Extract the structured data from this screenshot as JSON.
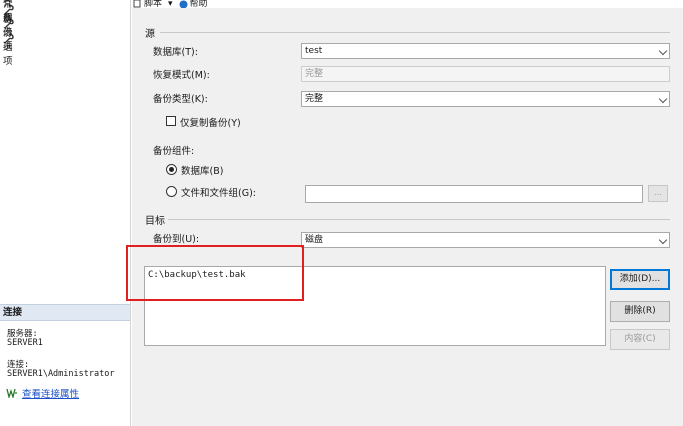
{
  "left_pane": {
    "pages": [
      "常规",
      "介质选项",
      "备份选项"
    ],
    "connection": {
      "header": "连接",
      "server_label": "服务器:",
      "server_value": "SERVER1",
      "conn_label": "连接:",
      "conn_value": "SERVER1\\Administrator",
      "view_props_link": "查看连接属性"
    }
  },
  "toolbar": {
    "script_label": "脚本",
    "dropdown_glyph": "▾",
    "help_label": "帮助"
  },
  "source": {
    "section_title": "源",
    "database_label": "数据库(T):",
    "database_value": "test",
    "recovery_label": "恢复模式(M):",
    "recovery_value": "完整",
    "backup_type_label": "备份类型(K):",
    "backup_type_value": "完整",
    "copy_only_label": "仅复制备份(Y)",
    "component_label": "备份组件:",
    "radio_database_label": "数据库(B)",
    "radio_files_label": "文件和文件组(G):",
    "browse_label": "..."
  },
  "destination": {
    "section_title": "目标",
    "backup_to_label": "备份到(U):",
    "backup_to_value": "磁盘",
    "paths": [
      "C:\\backup\\test.bak"
    ],
    "add_button": "添加(D)...",
    "remove_button": "删除(R)",
    "contents_button": "内容(C)"
  },
  "colors": {
    "highlight": "#e02020",
    "link": "#1a4fc9",
    "accent": "#0078d7"
  }
}
